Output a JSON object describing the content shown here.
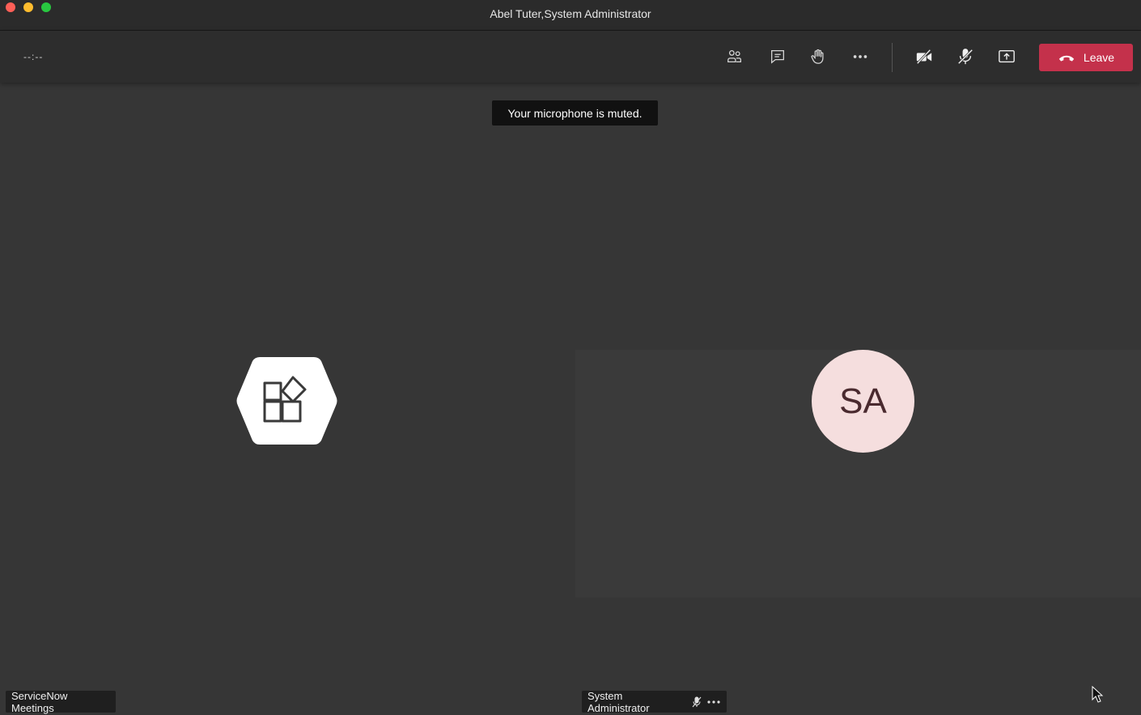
{
  "window": {
    "title": "Abel Tuter,System Administrator"
  },
  "toolbar": {
    "timer": "--:--",
    "buttons": [
      {
        "name": "participants",
        "icon": "people-icon"
      },
      {
        "name": "chat",
        "icon": "chat-icon"
      },
      {
        "name": "raise-hand",
        "icon": "hand-icon"
      },
      {
        "name": "more-actions",
        "icon": "more-icon"
      },
      {
        "name": "camera",
        "icon": "camera-off-icon"
      },
      {
        "name": "microphone",
        "icon": "mic-off-icon"
      },
      {
        "name": "share",
        "icon": "share-screen-icon"
      }
    ],
    "leave_label": "Leave",
    "leave_color": "#c4314b"
  },
  "toast": {
    "text": "Your microphone is muted."
  },
  "tiles": {
    "left": {
      "name": "ServiceNow Meetings",
      "icon": "apps-hexagon-icon"
    },
    "right": {
      "initials": "SA",
      "name": "System Administrator",
      "avatar_color": "#f5dede",
      "status_icons": [
        "mic-off-icon",
        "more-icon"
      ]
    }
  },
  "colors": {
    "background": "#363636",
    "titlebar": "#2b2b2b",
    "toolbar": "#2d2d2d"
  }
}
